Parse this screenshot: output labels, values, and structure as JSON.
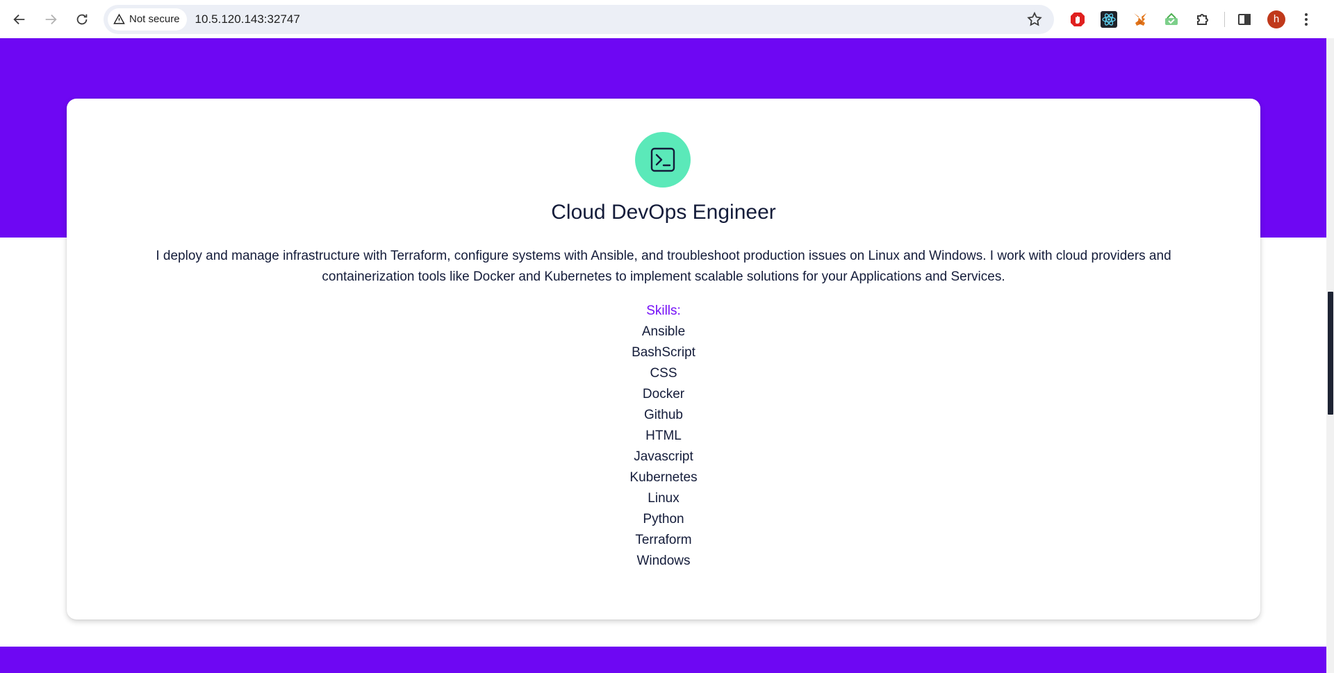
{
  "browser": {
    "security_label": "Not secure",
    "url": "10.5.120.143:32747",
    "profile_initial": "h",
    "extensions": [
      "adblock-icon",
      "react-devtools-icon",
      "metamask-icon",
      "extension-icon",
      "puzzle-extensions-icon"
    ]
  },
  "colors": {
    "brand_purple": "#6e07f3",
    "accent_green": "#5be9b9",
    "skills_label": "#7510f7",
    "text_dark": "#141c3a"
  },
  "card": {
    "icon": "terminal-icon",
    "title": "Cloud DevOps Engineer",
    "description": "I deploy and manage infrastructure with Terraform, configure systems with Ansible, and troubleshoot production issues on Linux and Windows. I work with cloud providers and containerization tools like Docker and Kubernetes to implement scalable solutions for your Applications and Services.",
    "skills_label": "Skills:",
    "skills": [
      "Ansible",
      "BashScript",
      "CSS",
      "Docker",
      "Github",
      "HTML",
      "Javascript",
      "Kubernetes",
      "Linux",
      "Python",
      "Terraform",
      "Windows"
    ]
  }
}
